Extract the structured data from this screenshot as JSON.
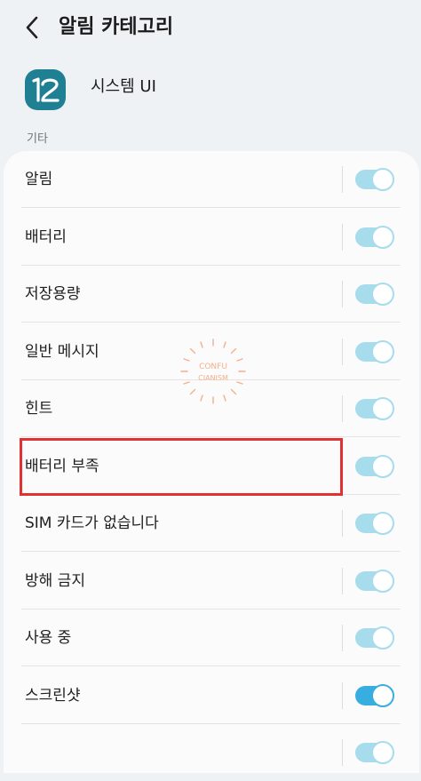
{
  "header": {
    "title": "알림 카테고리"
  },
  "app": {
    "icon_text": "12",
    "name": "시스템 UI",
    "icon_color": "#1f7f93"
  },
  "section": {
    "label": "기타"
  },
  "items": [
    {
      "label": "알림",
      "state": "on"
    },
    {
      "label": "배터리",
      "state": "on"
    },
    {
      "label": "저장용량",
      "state": "on"
    },
    {
      "label": "일반 메시지",
      "state": "on"
    },
    {
      "label": "힌트",
      "state": "on"
    },
    {
      "label": "배터리 부족",
      "state": "on"
    },
    {
      "label": "SIM 카드가 없습니다",
      "state": "on"
    },
    {
      "label": "방해 금지",
      "state": "on"
    },
    {
      "label": "사용 중",
      "state": "on"
    },
    {
      "label": "스크린샷",
      "state": "on"
    }
  ],
  "watermark": {
    "line1": "CONFU",
    "line2": "CIANISM"
  },
  "colors": {
    "toggle_light": "#a6dcec",
    "toggle_active": "#38aee0",
    "highlight": "#e03232",
    "background": "#eef2f4"
  }
}
